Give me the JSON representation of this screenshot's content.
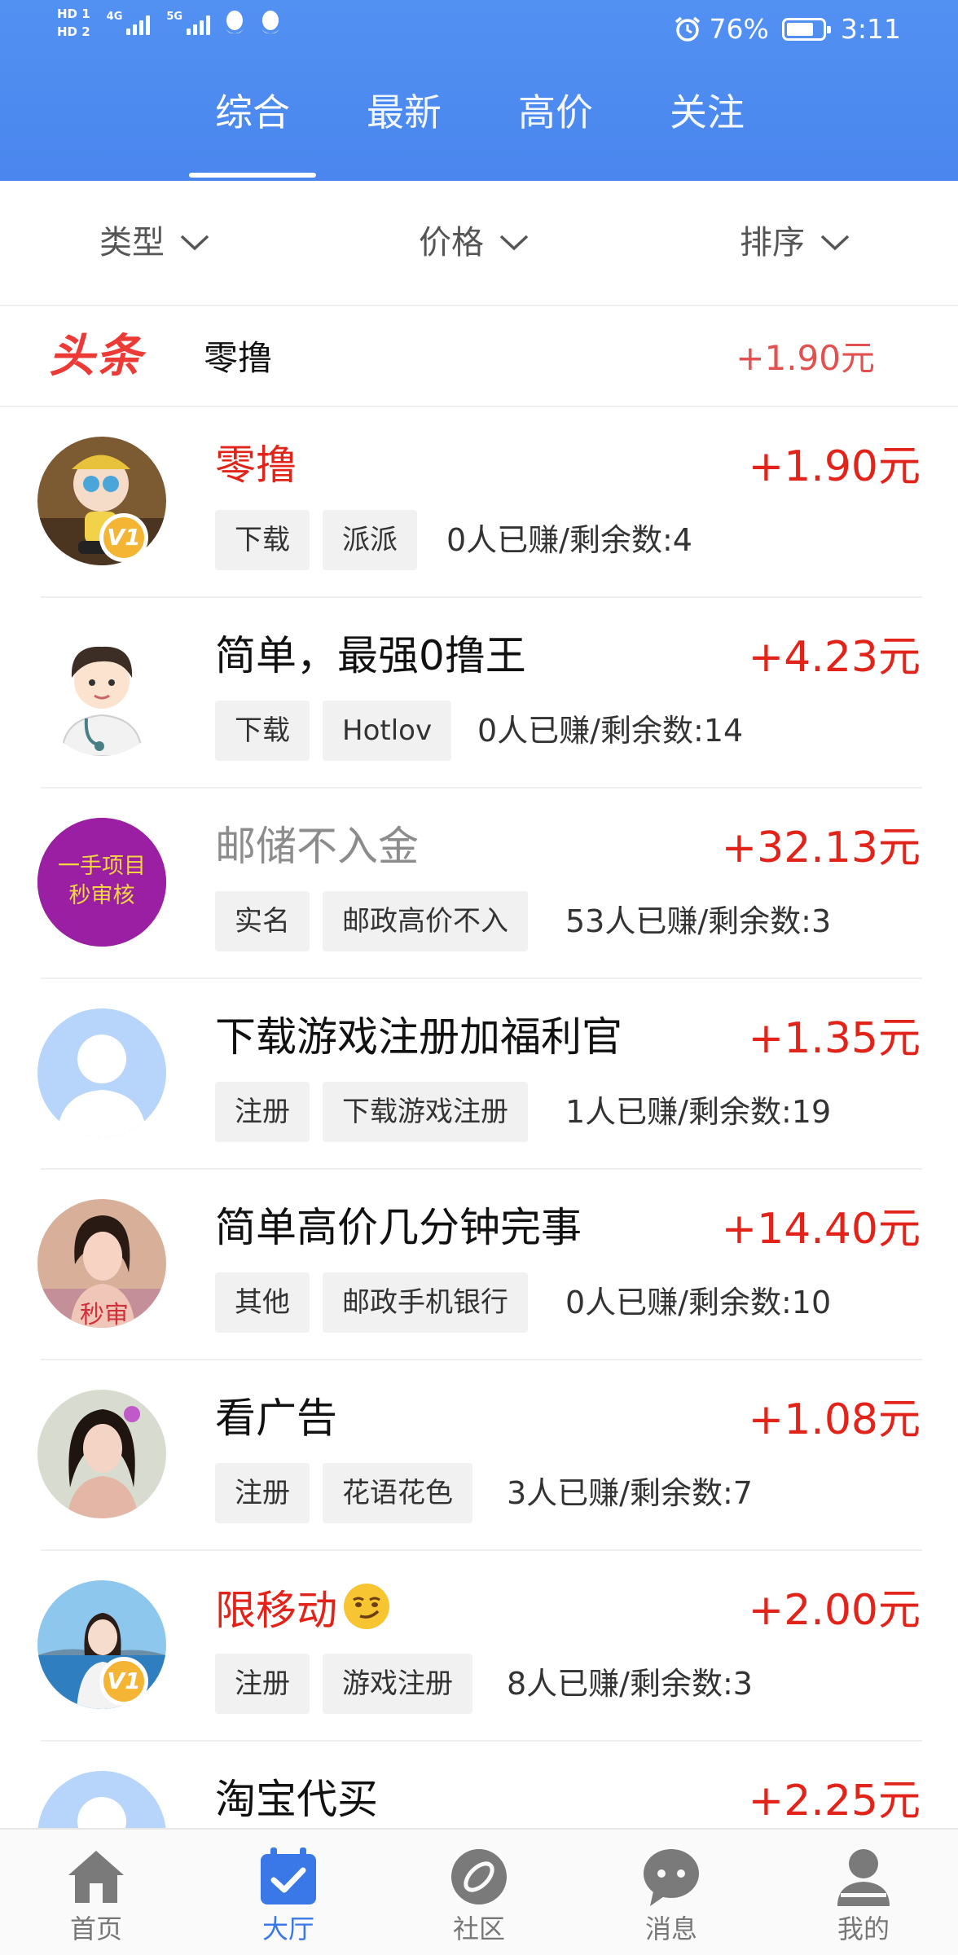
{
  "status_bar": {
    "hd1": "HD 1",
    "hd2": "HD 2",
    "net1": "4G",
    "net2": "5G",
    "battery_percent": "76%",
    "battery_level": 0.76,
    "time": "3:11",
    "icons": [
      "signal-icon",
      "qq-icon",
      "alarm-icon",
      "battery-icon"
    ]
  },
  "top_tabs": [
    {
      "label": "综合",
      "active": true
    },
    {
      "label": "最新",
      "active": false
    },
    {
      "label": "高价",
      "active": false
    },
    {
      "label": "关注",
      "active": false
    }
  ],
  "filters": [
    {
      "label": "类型"
    },
    {
      "label": "价格"
    },
    {
      "label": "排序"
    }
  ],
  "headline": {
    "logo_text": "头条",
    "title": "零撸",
    "price": "+1.90元"
  },
  "tasks": [
    {
      "title": "零撸",
      "title_color": "#e2231a",
      "price": "+1.90元",
      "tags": [
        "下载",
        "派派"
      ],
      "stats": "0人已赚/剩余数:4",
      "avatar": "toy-figure",
      "badge": "V1"
    },
    {
      "title": "简单，最强0撸王",
      "price": "+4.23元",
      "tags": [
        "下载",
        "Hotlov"
      ],
      "stats": "0人已赚/剩余数:14",
      "avatar": "doctor-cartoon"
    },
    {
      "title": "邮储不入金",
      "title_color": "#8c8c8c",
      "price": "+32.13元",
      "tags": [
        "实名",
        "邮政高价不入"
      ],
      "stats": "53人已赚/剩余数:3",
      "avatar": "purple-text",
      "avatar_text": [
        "一手项目",
        "秒审核"
      ]
    },
    {
      "title": "下载游戏注册加福利官",
      "price": "+1.35元",
      "tags": [
        "注册",
        "下载游戏注册"
      ],
      "stats": "1人已赚/剩余数:19",
      "avatar": "default-user"
    },
    {
      "title": "简单高价几分钟完事",
      "price": "+14.40元",
      "tags": [
        "其他",
        "邮政手机银行"
      ],
      "stats": "0人已赚/剩余数:10",
      "avatar": "woman-photo-1"
    },
    {
      "title": "看广告",
      "price": "+1.08元",
      "tags": [
        "注册",
        "花语花色"
      ],
      "stats": "3人已赚/剩余数:7",
      "avatar": "woman-photo-2"
    },
    {
      "title": "限移动",
      "title_color": "#e2231a",
      "title_emoji": "smirk-emoji",
      "price": "+2.00元",
      "tags": [
        "注册",
        "游戏注册"
      ],
      "stats": "8人已赚/剩余数:3",
      "avatar": "beach-photo",
      "badge": "V1"
    },
    {
      "title": "淘宝代买",
      "price": "+2.25元",
      "tags": [],
      "stats": "",
      "avatar": "default-user"
    }
  ],
  "bottom_nav": [
    {
      "label": "首页",
      "icon": "home-icon",
      "active": false
    },
    {
      "label": "大厅",
      "icon": "calendar-check-icon",
      "active": true
    },
    {
      "label": "社区",
      "icon": "compass-icon",
      "active": false
    },
    {
      "label": "消息",
      "icon": "chat-icon",
      "active": false
    },
    {
      "label": "我的",
      "icon": "user-icon",
      "active": false
    }
  ],
  "colors": {
    "header_blue": "#4a86ee",
    "price_red": "#e2231a",
    "active_nav": "#3a78e8"
  }
}
